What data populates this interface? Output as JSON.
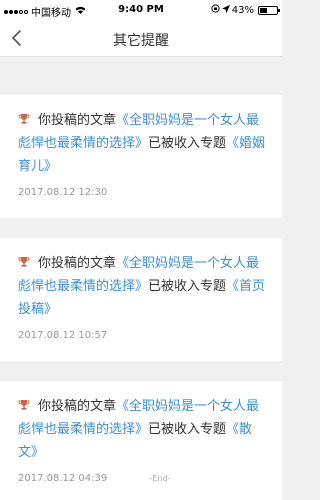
{
  "status_bar": {
    "carrier": "中国移动",
    "time": "9:40 PM",
    "battery_percent": "43%",
    "battery_level": 0.43
  },
  "nav": {
    "title": "其它提醒"
  },
  "notifications": [
    {
      "prefix": "你投稿的文章",
      "article": "《全职妈妈是一个女人最彪悍也最柔情的选择》",
      "middle": "已被收入专题",
      "topic": "《婚姻育儿》",
      "date": "2017.08.12 12:30"
    },
    {
      "prefix": "你投稿的文章",
      "article": "《全职妈妈是一个女人最彪悍也最柔情的选择》",
      "middle": "已被收入专题",
      "topic": "《首页投稿》",
      "date": "2017.08.12 10:57"
    },
    {
      "prefix": "你投稿的文章",
      "article": "《全职妈妈是一个女人最彪悍也最柔情的选择》",
      "middle": "已被收入专题",
      "topic": "《散文》",
      "date": "2017.08.12 04:39"
    }
  ],
  "footer": {
    "end_text": "-End-"
  },
  "colors": {
    "link": "#3f8fce",
    "trophy": "#c8664a"
  }
}
